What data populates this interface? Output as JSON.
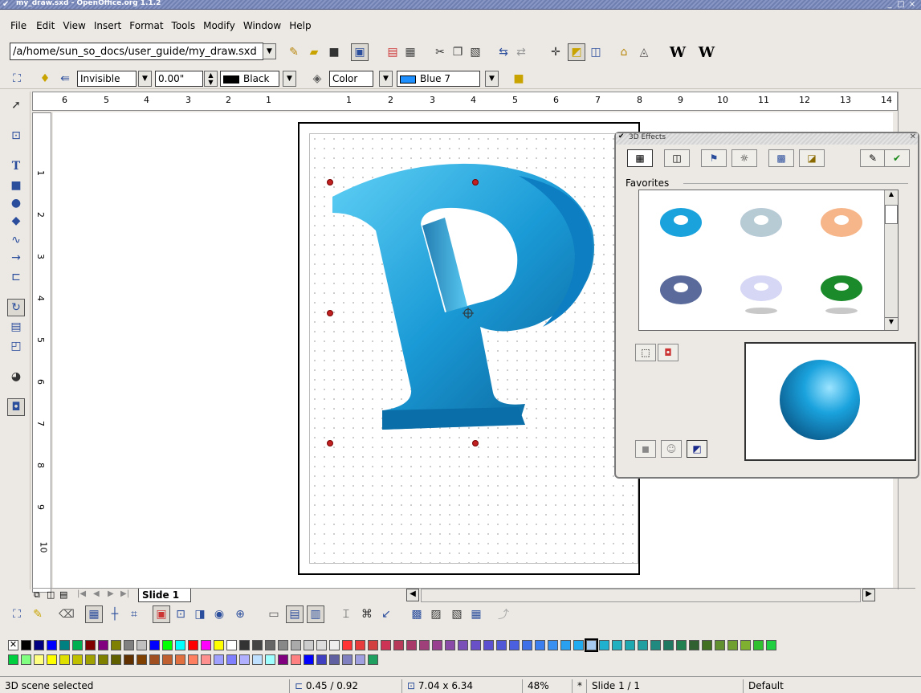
{
  "window": {
    "title": "my_draw.sxd - OpenOffice.org 1.1.2",
    "min": "_",
    "max": "□",
    "close": "×"
  },
  "menu": [
    "File",
    "Edit",
    "View",
    "Insert",
    "Format",
    "Tools",
    "Modify",
    "Window",
    "Help"
  ],
  "funcbar": {
    "url": "/a/home/sun_so_docs/user_guide/my_draw.sxd",
    "w1": "W",
    "w2": "W"
  },
  "objbar": {
    "line_style": "Invisible",
    "line_width": "0.00\"",
    "line_color": "Black",
    "line_color_hex": "#000000",
    "area_style": "Color",
    "area_color": "Blue 7",
    "area_color_hex": "#1e90ff"
  },
  "hruler_labels": [
    "6",
    "5",
    "4",
    "3",
    "2",
    "1",
    "1",
    "2",
    "3",
    "4",
    "5",
    "6",
    "7",
    "8",
    "9",
    "10",
    "11",
    "12",
    "13",
    "14"
  ],
  "vruler_labels": [
    "1",
    "2",
    "3",
    "4",
    "5",
    "6",
    "7",
    "8",
    "9",
    "10"
  ],
  "fx": {
    "title": "3D Effects",
    "favorites_label": "Favorites"
  },
  "tabs": {
    "slide_tab": "Slide 1"
  },
  "palette": {
    "row1": [
      "#000000",
      "#000080",
      "#0000ff",
      "#008080",
      "#00b050",
      "#800000",
      "#800080",
      "#808000",
      "#808080",
      "#c0c0c0",
      "#0000ff",
      "#00ff00",
      "#00ffff",
      "#ff0000",
      "#ff00ff",
      "#ffff00",
      "#ffffff",
      "#333333",
      "#444444",
      "#666666",
      "#888888",
      "#aaaaaa",
      "#cccccc",
      "#dddddd",
      "#eeeeee",
      "#ff3333",
      "#e83b3b",
      "#d24040",
      "#cc3355",
      "#b83a5a",
      "#a83a6a",
      "#a0407a",
      "#9a4090",
      "#8a4aa8",
      "#7a50b8",
      "#6a50c8",
      "#5a50d0",
      "#5058d8",
      "#4a60e0",
      "#4070e8",
      "#3a7ef0",
      "#3a90f0",
      "#2aa0f0",
      "#20aaf0",
      "#a6caf0",
      "#20b0d0",
      "#20b0c0",
      "#20a8b0",
      "#20a0a0",
      "#208a80",
      "#207860",
      "#208050",
      "#306030",
      "#407020",
      "#609030",
      "#70a030",
      "#80b030",
      "#30c030",
      "#20d040"
    ],
    "row2": [
      "#00d040",
      "#80ff80",
      "#ffff80",
      "#ffff00",
      "#e0e000",
      "#c0c000",
      "#a0a000",
      "#808000",
      "#606000",
      "#603000",
      "#804000",
      "#a05020",
      "#c06030",
      "#e07040",
      "#ff8060",
      "#ff9090",
      "#a0a0ff",
      "#8080ff",
      "#b0b0ff",
      "#c0e0ff",
      "#a0ffff",
      "#800080",
      "#ff8080",
      "#0000ff",
      "#4040c0",
      "#6060a0",
      "#8080c0",
      "#a0a0e0",
      "#20a060"
    ]
  },
  "status": {
    "message": "3D scene selected",
    "position": "0.45 / 0.92",
    "size": "7.04 x 6.34",
    "zoom": "48%",
    "modified": "*",
    "slide": "Slide 1 / 1",
    "layout": "Default"
  }
}
